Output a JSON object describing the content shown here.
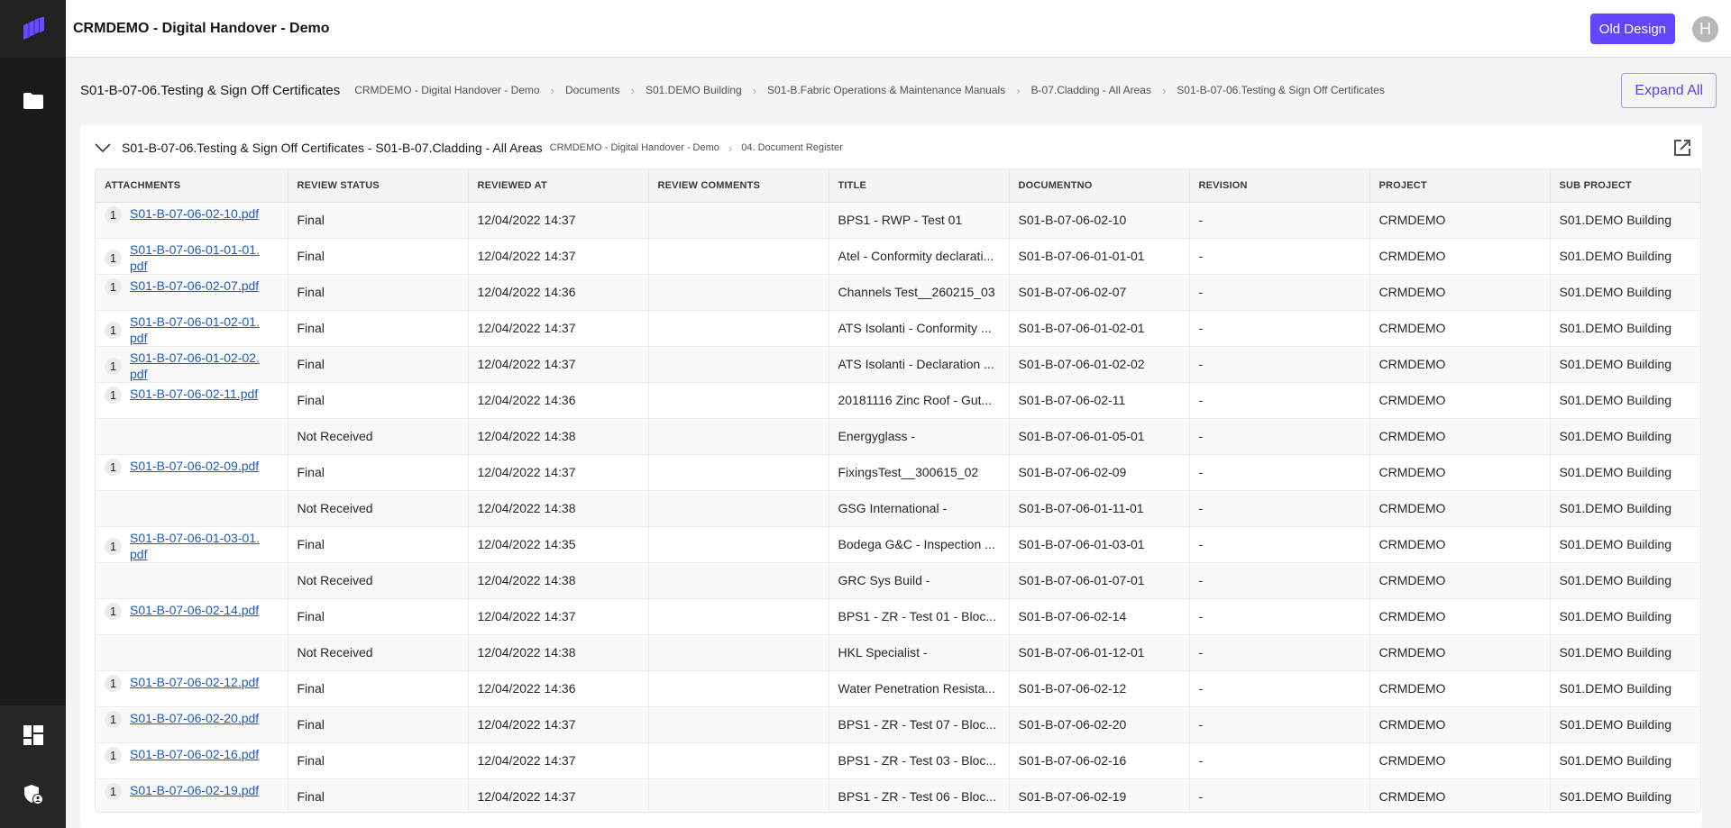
{
  "app": {
    "title": "CRMDEMO - Digital Handover - Demo",
    "old_design_label": "Old Design",
    "avatar_initial": "H",
    "accent_color": "#6246ff"
  },
  "sidebar": {
    "items": [
      {
        "name": "logo-icon"
      },
      {
        "name": "folder-icon"
      },
      {
        "name": "dashboard-icon"
      },
      {
        "name": "shield-user-icon"
      }
    ]
  },
  "subheader": {
    "page_title": "S01-B-07-06.Testing & Sign Off Certificates",
    "breadcrumb": [
      "CRMDEMO - Digital Handover - Demo",
      "Documents",
      "S01.DEMO Building",
      "S01-B.Fabric Operations & Maintenance Manuals",
      "B-07.Cladding - All Areas",
      "S01-B-07-06.Testing & Sign Off Certificates"
    ],
    "expand_all_label": "Expand All"
  },
  "card": {
    "title": "S01-B-07-06.Testing & Sign Off Certificates - S01-B-07.Cladding - All Areas",
    "breadcrumb": [
      "CRMDEMO - Digital Handover - Demo",
      "04. Document Register"
    ]
  },
  "table": {
    "columns": [
      "ATTACHMENTS",
      "REVIEW STATUS",
      "REVIEWED AT",
      "REVIEW COMMENTS",
      "TITLE",
      "DOCUMENTNO",
      "REVISION",
      "PROJECT",
      "SUB PROJECT"
    ],
    "rows": [
      {
        "att_count": "1",
        "att_file": "S01-B-07-06-02-10.pdf",
        "status": "Final",
        "reviewed_at": "12/04/2022 14:37",
        "comments": "",
        "title": "BPS1 - RWP - Test 01",
        "docno": "S01-B-07-06-02-10",
        "revision": "-",
        "project": "CRMDEMO",
        "subproject": "S01.DEMO Building"
      },
      {
        "att_count": "1",
        "att_file": "S01-B-07-06-01-01-01.pdf",
        "status": "Final",
        "reviewed_at": "12/04/2022 14:37",
        "comments": "",
        "title": "Atel - Conformity declarati...",
        "docno": "S01-B-07-06-01-01-01",
        "revision": "-",
        "project": "CRMDEMO",
        "subproject": "S01.DEMO Building"
      },
      {
        "att_count": "1",
        "att_file": "S01-B-07-06-02-07.pdf",
        "status": "Final",
        "reviewed_at": "12/04/2022 14:36",
        "comments": "",
        "title": "Channels Test__260215_03",
        "docno": "S01-B-07-06-02-07",
        "revision": "-",
        "project": "CRMDEMO",
        "subproject": "S01.DEMO Building"
      },
      {
        "att_count": "1",
        "att_file": "S01-B-07-06-01-02-01.pdf",
        "status": "Final",
        "reviewed_at": "12/04/2022 14:37",
        "comments": "",
        "title": "ATS Isolanti - Conformity ...",
        "docno": "S01-B-07-06-01-02-01",
        "revision": "-",
        "project": "CRMDEMO",
        "subproject": "S01.DEMO Building"
      },
      {
        "att_count": "1",
        "att_file": "S01-B-07-06-01-02-02.pdf",
        "status": "Final",
        "reviewed_at": "12/04/2022 14:37",
        "comments": "",
        "title": "ATS Isolanti - Declaration ...",
        "docno": "S01-B-07-06-01-02-02",
        "revision": "-",
        "project": "CRMDEMO",
        "subproject": "S01.DEMO Building"
      },
      {
        "att_count": "1",
        "att_file": "S01-B-07-06-02-11.pdf",
        "status": "Final",
        "reviewed_at": "12/04/2022 14:36",
        "comments": "",
        "title": "20181116 Zinc Roof - Gut...",
        "docno": "S01-B-07-06-02-11",
        "revision": "-",
        "project": "CRMDEMO",
        "subproject": "S01.DEMO Building"
      },
      {
        "att_count": "",
        "att_file": "",
        "status": "Not Received",
        "reviewed_at": "12/04/2022 14:38",
        "comments": "",
        "title": "Energyglass -",
        "docno": "S01-B-07-06-01-05-01",
        "revision": "-",
        "project": "CRMDEMO",
        "subproject": "S01.DEMO Building"
      },
      {
        "att_count": "1",
        "att_file": "S01-B-07-06-02-09.pdf",
        "status": "Final",
        "reviewed_at": "12/04/2022 14:37",
        "comments": "",
        "title": "FixingsTest__300615_02",
        "docno": "S01-B-07-06-02-09",
        "revision": "-",
        "project": "CRMDEMO",
        "subproject": "S01.DEMO Building"
      },
      {
        "att_count": "",
        "att_file": "",
        "status": "Not Received",
        "reviewed_at": "12/04/2022 14:38",
        "comments": "",
        "title": "GSG International -",
        "docno": "S01-B-07-06-01-11-01",
        "revision": "-",
        "project": "CRMDEMO",
        "subproject": "S01.DEMO Building"
      },
      {
        "att_count": "1",
        "att_file": "S01-B-07-06-01-03-01.pdf",
        "status": "Final",
        "reviewed_at": "12/04/2022 14:35",
        "comments": "",
        "title": "Bodega G&C - Inspection ...",
        "docno": "S01-B-07-06-01-03-01",
        "revision": "-",
        "project": "CRMDEMO",
        "subproject": "S01.DEMO Building"
      },
      {
        "att_count": "",
        "att_file": "",
        "status": "Not Received",
        "reviewed_at": "12/04/2022 14:38",
        "comments": "",
        "title": "GRC Sys Build -",
        "docno": "S01-B-07-06-01-07-01",
        "revision": "-",
        "project": "CRMDEMO",
        "subproject": "S01.DEMO Building"
      },
      {
        "att_count": "1",
        "att_file": "S01-B-07-06-02-14.pdf",
        "status": "Final",
        "reviewed_at": "12/04/2022 14:37",
        "comments": "",
        "title": "BPS1 - ZR - Test 01 - Bloc...",
        "docno": "S01-B-07-06-02-14",
        "revision": "-",
        "project": "CRMDEMO",
        "subproject": "S01.DEMO Building"
      },
      {
        "att_count": "",
        "att_file": "",
        "status": "Not Received",
        "reviewed_at": "12/04/2022 14:38",
        "comments": "",
        "title": "HKL Specialist -",
        "docno": "S01-B-07-06-01-12-01",
        "revision": "-",
        "project": "CRMDEMO",
        "subproject": "S01.DEMO Building"
      },
      {
        "att_count": "1",
        "att_file": "S01-B-07-06-02-12.pdf",
        "status": "Final",
        "reviewed_at": "12/04/2022 14:36",
        "comments": "",
        "title": "Water Penetration Resista...",
        "docno": "S01-B-07-06-02-12",
        "revision": "-",
        "project": "CRMDEMO",
        "subproject": "S01.DEMO Building"
      },
      {
        "att_count": "1",
        "att_file": "S01-B-07-06-02-20.pdf",
        "status": "Final",
        "reviewed_at": "12/04/2022 14:37",
        "comments": "",
        "title": "BPS1 - ZR - Test 07 - Bloc...",
        "docno": "S01-B-07-06-02-20",
        "revision": "-",
        "project": "CRMDEMO",
        "subproject": "S01.DEMO Building"
      },
      {
        "att_count": "1",
        "att_file": "S01-B-07-06-02-16.pdf",
        "status": "Final",
        "reviewed_at": "12/04/2022 14:37",
        "comments": "",
        "title": "BPS1 - ZR - Test 03 - Bloc...",
        "docno": "S01-B-07-06-02-16",
        "revision": "-",
        "project": "CRMDEMO",
        "subproject": "S01.DEMO Building"
      },
      {
        "att_count": "1",
        "att_file": "S01-B-07-06-02-19.pdf",
        "status": "Final",
        "reviewed_at": "12/04/2022 14:37",
        "comments": "",
        "title": "BPS1 - ZR - Test 06 - Bloc...",
        "docno": "S01-B-07-06-02-19",
        "revision": "-",
        "project": "CRMDEMO",
        "subproject": "S01.DEMO Building"
      }
    ]
  }
}
